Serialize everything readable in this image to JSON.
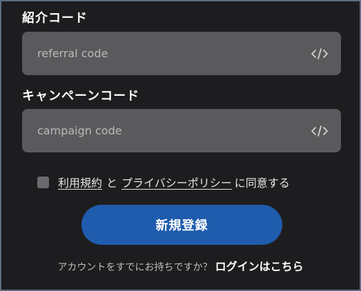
{
  "referral": {
    "label": "紹介コード",
    "placeholder": "referral code",
    "icon": "code-icon"
  },
  "campaign": {
    "label": "キャンペーンコード",
    "placeholder": "campaign code",
    "icon": "code-icon"
  },
  "agreement": {
    "terms_link": "利用規約",
    "and": "と",
    "privacy_link": "プライバシーポリシー",
    "suffix": "に同意する",
    "checked": false
  },
  "submit_label": "新規登録",
  "login": {
    "prompt": "アカウントをすでにお持ちですか？",
    "link": "ログインはこちら"
  },
  "colors": {
    "background": "#1d1d1f",
    "field": "#5a5a5c",
    "button": "#1f5cad",
    "frame_border": "#5c6d82"
  }
}
